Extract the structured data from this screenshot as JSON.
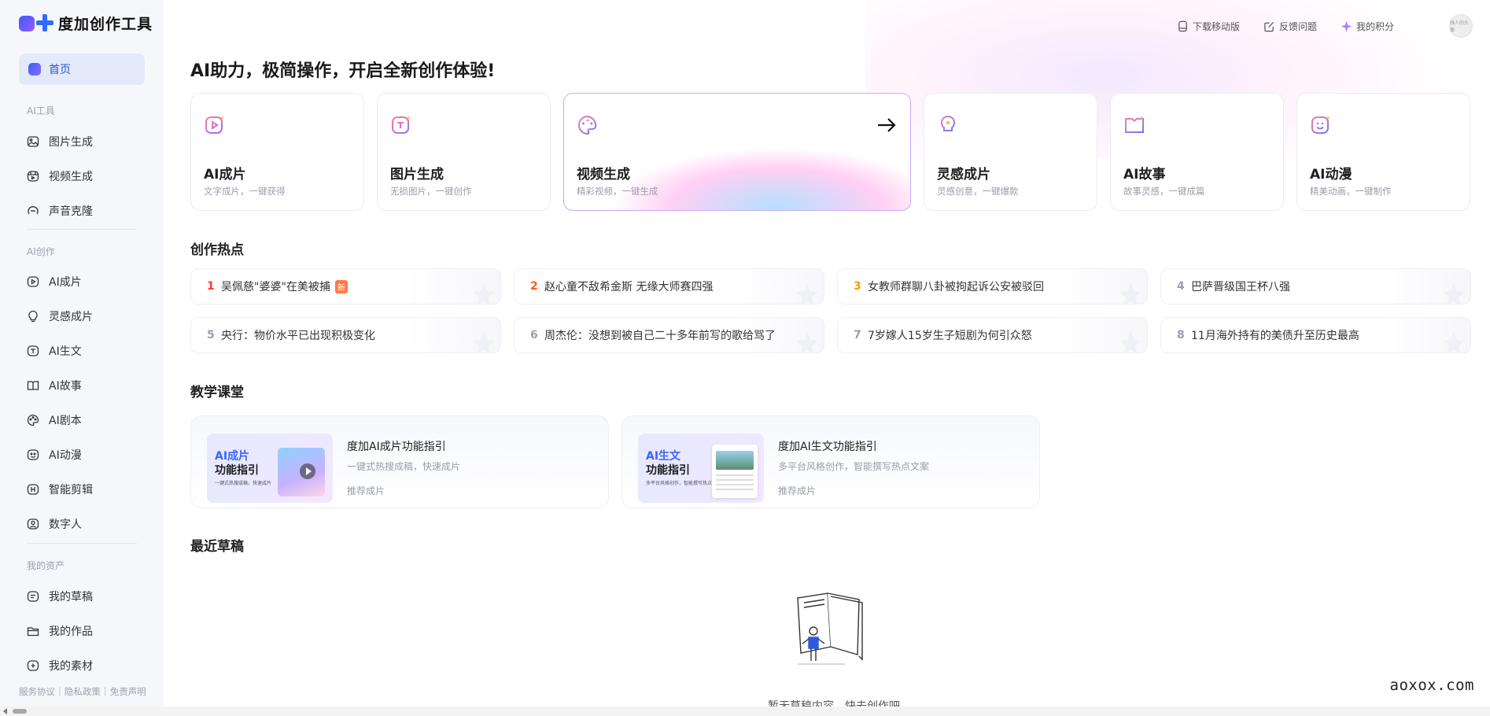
{
  "app": {
    "logo_text": "度加创作工具"
  },
  "sidebar": {
    "home": "首页",
    "section_ai_tools": "AI工具",
    "ai_tools": [
      {
        "label": "图片生成",
        "icon": "image-icon"
      },
      {
        "label": "视频生成",
        "icon": "video-icon"
      },
      {
        "label": "声音克隆",
        "icon": "voice-icon"
      }
    ],
    "section_ai_create": "AI创作",
    "ai_create": [
      {
        "label": "AI成片",
        "icon": "play-icon"
      },
      {
        "label": "灵感成片",
        "icon": "bulb-icon"
      },
      {
        "label": "AI生文",
        "icon": "text-icon"
      },
      {
        "label": "AI故事",
        "icon": "book-icon"
      },
      {
        "label": "AI剧本",
        "icon": "palette-icon"
      },
      {
        "label": "AI动漫",
        "icon": "smile-icon"
      },
      {
        "label": "智能剪辑",
        "icon": "clip-icon"
      },
      {
        "label": "数字人",
        "icon": "person-icon"
      }
    ],
    "section_assets": "我的资产",
    "assets": [
      {
        "label": "我的草稿",
        "icon": "draft-icon"
      },
      {
        "label": "我的作品",
        "icon": "folder-icon"
      },
      {
        "label": "我的素材",
        "icon": "plus-box-icon"
      }
    ],
    "footer": {
      "terms": "服务协议",
      "privacy": "隐私政策",
      "disclaimer": "免责声明",
      "sep": "|"
    }
  },
  "topbar": {
    "download": "下载移动版",
    "feedback": "反馈问题",
    "points": "我的积分",
    "avatar_text": "强人的头像"
  },
  "main": {
    "headline": "AI助力，极简操作，开启全新创作体验!",
    "cards": [
      {
        "title": "AI成片",
        "sub": "文字成片，一键获得",
        "icon": "ai-film-icon"
      },
      {
        "title": "图片生成",
        "sub": "无损图片，一键创作",
        "icon": "image-gen-icon"
      },
      {
        "title": "视频生成",
        "sub": "精彩视频，一键生成",
        "icon": "video-gen-icon"
      },
      {
        "title": "灵感成片",
        "sub": "灵感创意，一键爆款",
        "icon": "bulb-icon"
      },
      {
        "title": "AI故事",
        "sub": "故事灵感，一键成篇",
        "icon": "story-icon"
      },
      {
        "title": "AI动漫",
        "sub": "精美动画，一键制作",
        "icon": "anime-icon"
      }
    ],
    "hot_title": "创作热点",
    "hot": [
      {
        "rank": "1",
        "text": "吴佩慈\"婆婆\"在美被捕",
        "badge": "新",
        "color": "#ff3b30"
      },
      {
        "rank": "2",
        "text": "赵心童不敌希金斯 无缘大师赛四强",
        "badge": "",
        "color": "#ff5a1f"
      },
      {
        "rank": "3",
        "text": "女教师群聊八卦被拘起诉公安被驳回",
        "badge": "",
        "color": "#ff9a00"
      },
      {
        "rank": "4",
        "text": "巴萨晋级国王杯八强",
        "badge": "",
        "color": "#9aa0ab"
      },
      {
        "rank": "5",
        "text": "央行：物价水平已出现积极变化",
        "badge": "",
        "color": "#9aa0ab"
      },
      {
        "rank": "6",
        "text": "周杰伦：没想到被自己二十多年前写的歌给骂了",
        "badge": "",
        "color": "#9aa0ab"
      },
      {
        "rank": "7",
        "text": "7岁嫁人15岁生子短剧为何引众怒",
        "badge": "",
        "color": "#9aa0ab"
      },
      {
        "rank": "8",
        "text": "11月海外持有的美债升至历史最高",
        "badge": "",
        "color": "#9aa0ab"
      }
    ],
    "course_title": "教学课堂",
    "courses": [
      {
        "thumb_l1": "AI成片",
        "thumb_l2": "功能指引",
        "thumb_l3": "一键式热搜成稿，快速成片",
        "title": "度加AI成片功能指引",
        "desc": "一键式热搜成稿，快速成片",
        "tag": "推荐成片"
      },
      {
        "thumb_l1": "AI生文",
        "thumb_l2": "功能指引",
        "thumb_l3": "多平台风格创作，智能撰写热点文案",
        "title": "度加AI生文功能指引",
        "desc": "多平台风格创作，智能撰写热点文案",
        "tag": "推荐成片"
      }
    ],
    "drafts_title": "最近草稿",
    "empty_text": "暂无草稿内容，快去创作吧"
  },
  "watermark": "aoxox.com",
  "colors": {
    "accent": "#2b55d9",
    "highlight_border": "#c9a9f3"
  }
}
